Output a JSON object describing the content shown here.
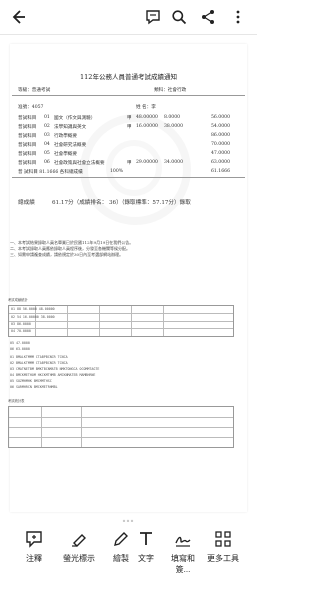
{
  "doc": {
    "title": "112年公務人員普通考試成績通知",
    "exam_level": "等級：普通考試",
    "category": "類科：社會行政",
    "admission_no": "准號：4057",
    "name": "姓  名：李",
    "subjects": [
      {
        "kind": "普試科目",
        "code": "01",
        "name": "國文（作文與測驗）",
        "a": "甲",
        "s1": "48.00000",
        "s2": "8.0000",
        "score": "56.0000"
      },
      {
        "kind": "普試科目",
        "code": "02",
        "name": "法學知識與英文",
        "a": "甲",
        "s1": "16.00000",
        "s2": "38.0000",
        "score": "54.0000"
      },
      {
        "kind": "普試科目",
        "code": "03",
        "name": "行政學概要",
        "a": "",
        "s1": "",
        "s2": "",
        "score": "86.0000"
      },
      {
        "kind": "普試科目",
        "code": "04",
        "name": "社會研究法概要",
        "a": "",
        "s1": "",
        "s2": "",
        "score": "70.0000"
      },
      {
        "kind": "普試科目",
        "code": "05",
        "name": "社會學概要",
        "a": "",
        "s1": "",
        "s2": "",
        "score": "47.0000"
      },
      {
        "kind": "普試科目",
        "code": "06",
        "name": "社會政策與社會立法概要",
        "a": "甲",
        "s1": "29.00000",
        "s2": "34.0000",
        "score": "63.0000"
      }
    ],
    "avg_row": {
      "label": "普  試科目 81.1666 各科總成績",
      "pct": "100%",
      "score": "61.1666"
    },
    "total_label": "總成績",
    "total_text": "61.17分（成績排名：  36）（錄取標準：57.17分）錄取",
    "notes": [
      "一、本考試結果錄取人員名單業已於民國112年9月19日在我們公告。",
      "二、本考試錄取人員應依錄取人員程序後，分發至各機關等候分配。",
      "三、如需申請複查成績，請依規定於30日內至考選部網站辦理。"
    ]
  },
  "table_title": "考試成績統計",
  "table_lines": [
    "01  88  56.0000  48.00000",
    "02  54  16.00000  38.0000",
    "03  86.0000",
    "04  70.0000",
    "05  47.0000",
    "06  63.0000"
  ],
  "mini_lines": [
    "01  BMALKTMMM CTABPBCNCR TCNCA",
    "02  BMALKTMMM CTABPBCNCR TCNCA",
    "03  CMATNETBM BMKTBCNMATB NMKTONGCA OCOMMTAGTE",
    "04  BMCKMETHOM HKCKMTHMB AMCKNMATEB MAMBHRNE",
    "05  SOZMHMHK BMCMMTHSC",
    "06  SARMHRCN BMCKMETRHMBL"
  ],
  "table2_title": "考試統計表",
  "toolbar": {
    "items": [
      "注釋",
      "螢光標示",
      "繪製",
      "文字",
      "填寫和簽...",
      "更多工具"
    ]
  }
}
